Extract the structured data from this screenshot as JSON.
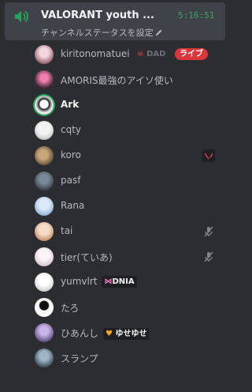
{
  "channel": {
    "name": "VALORANT youth ...",
    "elapsed": "5:16:51",
    "status_prompt": "チャンネルステータスを設定",
    "accent": "#23a559"
  },
  "members": [
    {
      "name": "kiritonomatuei",
      "tag": "DAD",
      "badge": "ライブ",
      "icon": "skull-icon"
    },
    {
      "name": "AMORIS最強のアイソ使い"
    },
    {
      "name": "Ark",
      "speaking": true
    },
    {
      "name": "cqty"
    },
    {
      "name": "koro",
      "activity_icon": "valorant-icon"
    },
    {
      "name": "pasf"
    },
    {
      "name": "Rana"
    },
    {
      "name": "tai",
      "muted": true
    },
    {
      "name": "tier(ていあ)",
      "muted": true
    },
    {
      "name": "yumvlrt",
      "tag": "DNIA",
      "icon": "bow-icon"
    },
    {
      "name": "たろ"
    },
    {
      "name": "ひあんし",
      "tag": "ゆせゆせ",
      "icon": "heart-icon"
    },
    {
      "name": "スランプ"
    }
  ]
}
